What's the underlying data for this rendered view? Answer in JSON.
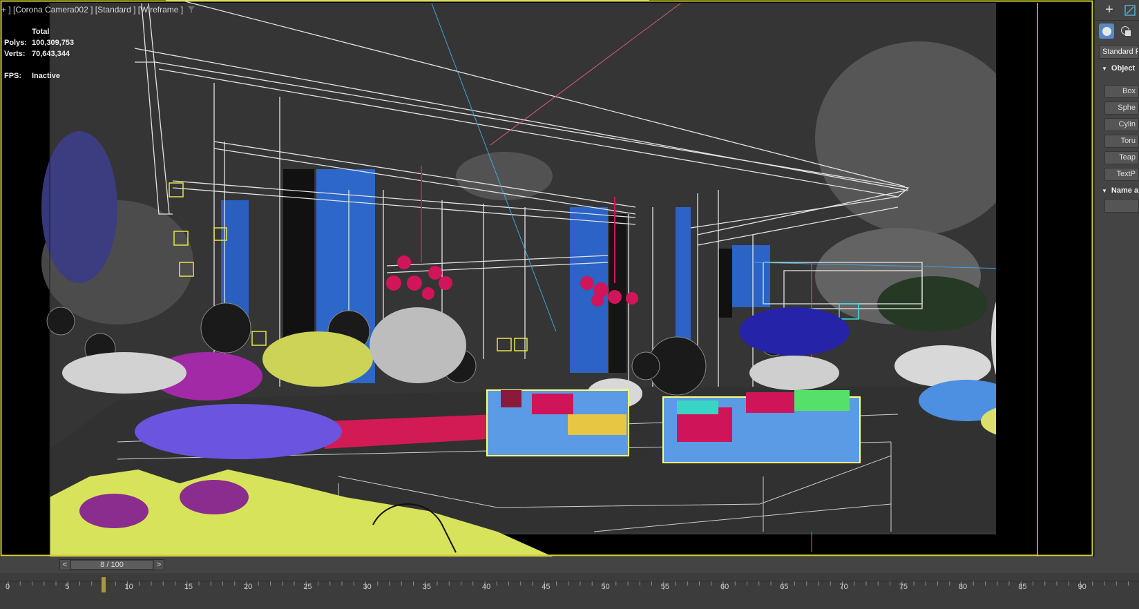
{
  "viewport": {
    "label": "+ ] [Corona Camera002 ] [Standard ] [Wireframe ]",
    "stats": {
      "header": "Total",
      "polys_label": "Polys:",
      "polys": "100,309,753",
      "verts_label": "Verts:",
      "verts": "70,643,344",
      "fps_label": "FPS:",
      "fps": "Inactive"
    }
  },
  "command_panel": {
    "dropdown_value": "Standard P",
    "object_type_rollout": "Object",
    "buttons": [
      "Box",
      "Sphe",
      "Cylin",
      "Toru",
      "Teap",
      "TextP"
    ],
    "name_rollout": "Name a"
  },
  "time_slider": {
    "position": "8 / 100",
    "current_frame": 8,
    "total_frames": 100,
    "prev": "<",
    "next": ">"
  },
  "trackbar": {
    "tick_labels": [
      "0",
      "5",
      "10",
      "15",
      "20",
      "25",
      "30",
      "35",
      "40",
      "45",
      "50",
      "55",
      "60",
      "65",
      "70",
      "75",
      "80",
      "85",
      "90"
    ]
  },
  "icons": {
    "create": "plus-icon",
    "modify": "modify-icon",
    "geometry": "sphere-icon",
    "shapes": "shapes-icon",
    "filter": "filter-icon"
  },
  "colors": {
    "viewport_border": "#d4cf3a",
    "active_tab": "#5a87c5",
    "key_marker": "#a89a3c"
  }
}
